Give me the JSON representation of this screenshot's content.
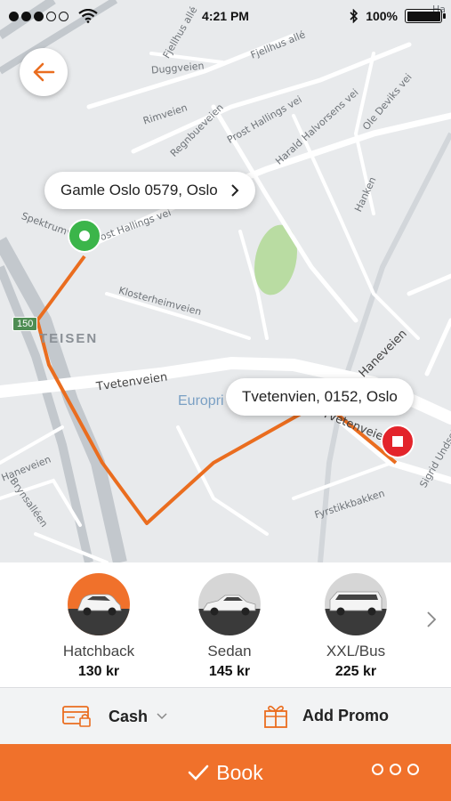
{
  "status_bar": {
    "time": "4:21 PM",
    "battery": "100%",
    "battery_level": 1.0,
    "signal_dots_filled": 3,
    "signal_dots_total": 5
  },
  "map": {
    "streets": [
      "Fjellhus allé",
      "Fjellhus allé",
      "Duggveien",
      "Rimveien",
      "Regnbueveien",
      "Prost Hallings vei",
      "Harald Halvorsens vei",
      "Ole Deviks vei",
      "Hanken",
      "Spektrumveien",
      "Prost Hallings vei",
      "Klosterheimveien",
      "Tvetenveien",
      "Tvetenveien",
      "Fyrstikkbakken",
      "Sigrid Undsets",
      "Brynsalléen",
      "Haneveien",
      "Haneveien"
    ],
    "district": "TEISEN",
    "poi": "Europri",
    "road_shield": "150",
    "corner_label": "Ha"
  },
  "route": {
    "color": "#ea6d1f",
    "origin_color": "#3bb54a",
    "destination_color": "#e3242b"
  },
  "origin_bubble": {
    "text": "Gamle Oslo 0579, Oslo",
    "chevron": "chevron-right-icon"
  },
  "destination_bubble": {
    "text": "Tvetenvien, 0152, Oslo"
  },
  "vehicles": [
    {
      "name": "Hatchback",
      "price": "130 kr",
      "selected": true
    },
    {
      "name": "Sedan",
      "price": "145 kr",
      "selected": false
    },
    {
      "name": "XXL/Bus",
      "price": "225 kr",
      "selected": false
    }
  ],
  "payment": {
    "method": "Cash",
    "promo": "Add Promo"
  },
  "book": {
    "label": "Book"
  },
  "colors": {
    "accent": "#f0712b",
    "selected_bg": "#f0712b"
  }
}
